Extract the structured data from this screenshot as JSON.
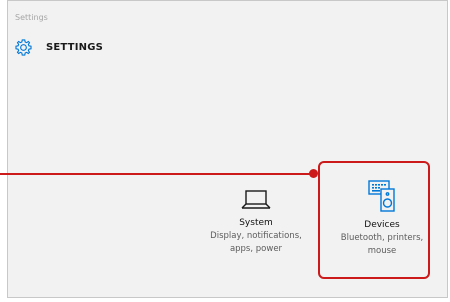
{
  "window": {
    "title": "Settings"
  },
  "header": {
    "icon": "gear-icon",
    "title": "SETTINGS"
  },
  "tiles": [
    {
      "icon": "laptop-icon",
      "name": "System",
      "desc_line1": "Display, notifications,",
      "desc_line2": "apps, power"
    },
    {
      "icon": "devices-icon",
      "name": "Devices",
      "desc_line1": "Bluetooth, printers,",
      "desc_line2": "mouse"
    }
  ],
  "colors": {
    "accent": "#0078d7",
    "highlight": "#cc1a1a",
    "background": "#f2f2f2"
  }
}
